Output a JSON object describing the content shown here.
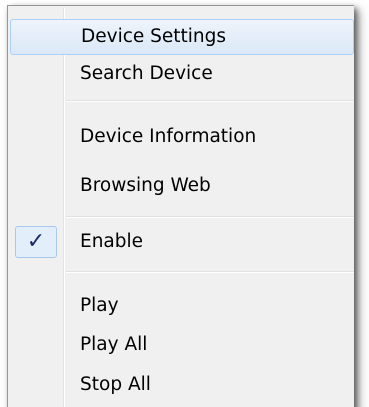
{
  "context_menu": {
    "items": [
      {
        "label": "Device Settings"
      },
      {
        "label": "Search Device"
      },
      {
        "label": "Device Information"
      },
      {
        "label": "Browsing Web"
      },
      {
        "label": "Enable",
        "checked": true,
        "check_glyph": "✓"
      },
      {
        "label": "Play"
      },
      {
        "label": "Play All"
      },
      {
        "label": "Stop All"
      }
    ],
    "highlighted_index": 0
  },
  "colors": {
    "menu_background": "#f0f0f0",
    "highlight_border": "#aecff7",
    "check_color": "#1c2b66"
  }
}
